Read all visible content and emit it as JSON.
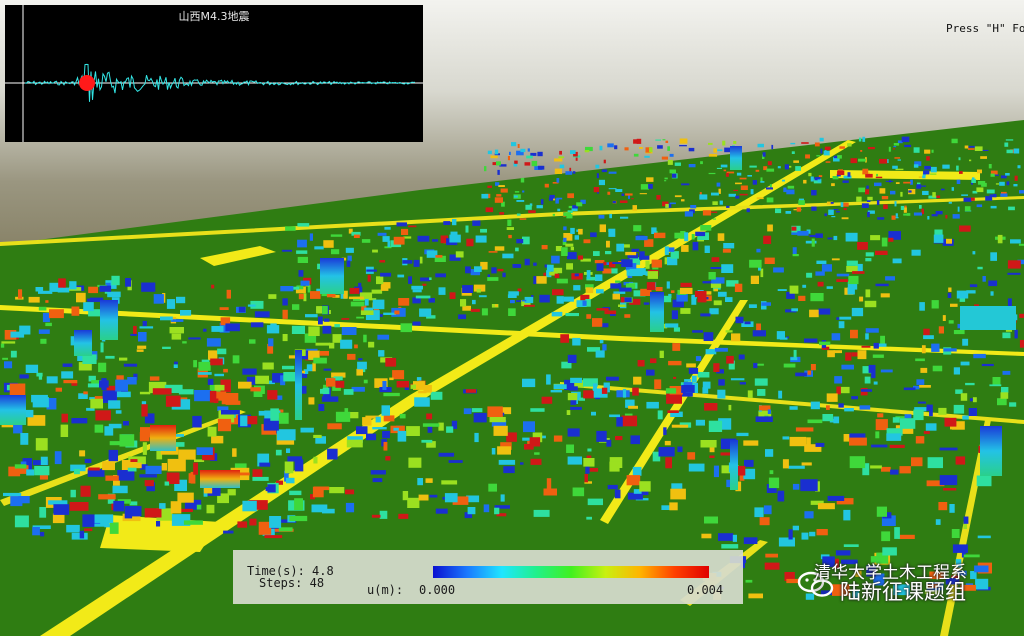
{
  "seismograph": {
    "title": "山西M4.3地震",
    "marker_color": "#ff1a1a",
    "trace_color": "#33e6e6"
  },
  "hint": {
    "text": "Press \"H\" Fo"
  },
  "status": {
    "time_label": "Time(s):",
    "time_value": "4.8",
    "steps_label": "Steps:",
    "steps_value": "48"
  },
  "legend": {
    "label": "u(m):",
    "min": "0.000",
    "max": "0.004",
    "colormap": [
      "#0a10d0",
      "#1a7aff",
      "#1fe6ff",
      "#20f08a",
      "#40f020",
      "#c8f010",
      "#ffb400",
      "#ff4000",
      "#e00000"
    ]
  },
  "watermark": {
    "line1": "清华大学土木工程系",
    "line2": "陆新征课题组",
    "icon": "wechat-icon"
  },
  "scene": {
    "ground_color": "#2f7d12",
    "road_color": "#f2ea18"
  }
}
